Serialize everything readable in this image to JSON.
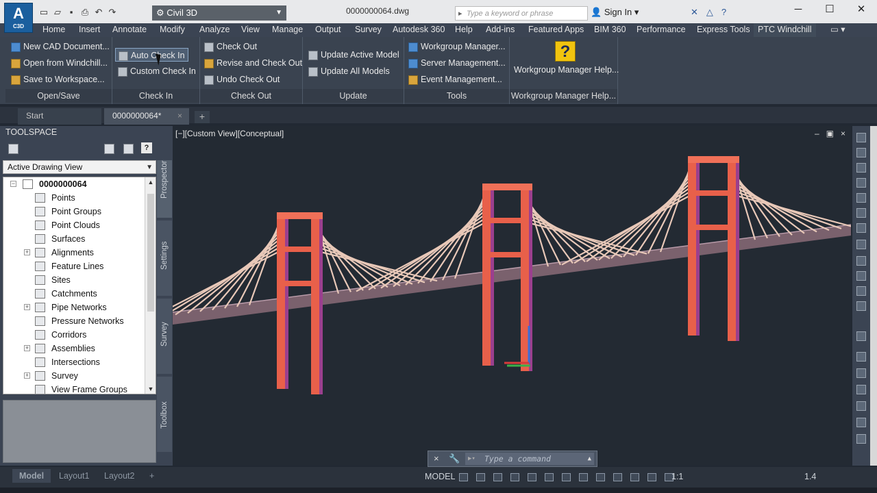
{
  "app": {
    "logo_text": "A",
    "logo_sub": "C3D",
    "workspace": "Civil 3D",
    "doc_title": "0000000064.dwg",
    "search_placeholder": "Type a keyword or phrase",
    "sign_in": "Sign In"
  },
  "ribbon_tabs": [
    "Home",
    "Insert",
    "Annotate",
    "Modify",
    "Analyze",
    "View",
    "Manage",
    "Output",
    "Survey",
    "Autodesk 360",
    "Help",
    "Add-ins",
    "Featured Apps",
    "BIM 360",
    "Performance",
    "Express Tools",
    "PTC Windchill"
  ],
  "active_ribbon_tab": "PTC Windchill",
  "ribbon": {
    "open_save": {
      "title": "Open/Save",
      "items": [
        "New CAD Document...",
        "Open from Windchill...",
        "Save to Workspace..."
      ]
    },
    "check_in": {
      "title": "Check In",
      "items": [
        "Auto Check In",
        "Custom Check In"
      ]
    },
    "check_out": {
      "title": "Check Out",
      "items": [
        "Check Out",
        "Revise and Check Out",
        "Undo Check Out"
      ]
    },
    "update": {
      "title": "Update",
      "items": [
        "Update Active Model",
        "Update All Models"
      ]
    },
    "tools": {
      "title": "Tools",
      "items": [
        "Workgroup Manager...",
        "Server Management...",
        "Event Management..."
      ]
    },
    "wgm_help": {
      "title": "Workgroup Manager Help...",
      "button": "Workgroup Manager Help...",
      "icon_glyph": "?"
    }
  },
  "doc_tabs": {
    "start": "Start",
    "current": "0000000064*",
    "close_glyph": "×",
    "add_glyph": "+"
  },
  "toolspace": {
    "title": "TOOLSPACE",
    "view_select": "Active Drawing View",
    "help_glyph": "?",
    "root": "0000000064",
    "items": [
      {
        "label": "Points",
        "expandable": false
      },
      {
        "label": "Point Groups",
        "expandable": false
      },
      {
        "label": "Point Clouds",
        "expandable": false
      },
      {
        "label": "Surfaces",
        "expandable": false
      },
      {
        "label": "Alignments",
        "expandable": true
      },
      {
        "label": "Feature Lines",
        "expandable": false
      },
      {
        "label": "Sites",
        "expandable": false
      },
      {
        "label": "Catchments",
        "expandable": false
      },
      {
        "label": "Pipe Networks",
        "expandable": true
      },
      {
        "label": "Pressure Networks",
        "expandable": false
      },
      {
        "label": "Corridors",
        "expandable": false
      },
      {
        "label": "Assemblies",
        "expandable": true
      },
      {
        "label": "Intersections",
        "expandable": false
      },
      {
        "label": "Survey",
        "expandable": true
      },
      {
        "label": "View Frame Groups",
        "expandable": false
      }
    ],
    "side_tabs": [
      "Prospector",
      "Settings",
      "Survey",
      "Toolbox"
    ]
  },
  "viewport": {
    "label": "[−][Custom View][Conceptual]",
    "controls": [
      "–",
      "▣",
      "×"
    ],
    "colors": {
      "tower": "#e8604a",
      "tower_shade": "#9b3f8e",
      "cable": "#e8c8b8",
      "deck": "#8a6b78"
    }
  },
  "command_line": {
    "placeholder": "Type a command",
    "close_glyph": "×"
  },
  "status": {
    "layout_tabs": [
      "Model",
      "Layout1",
      "Layout2"
    ],
    "add_glyph": "+",
    "model": "MODEL",
    "scale": "1:1",
    "annotation_scale": "1.4"
  }
}
